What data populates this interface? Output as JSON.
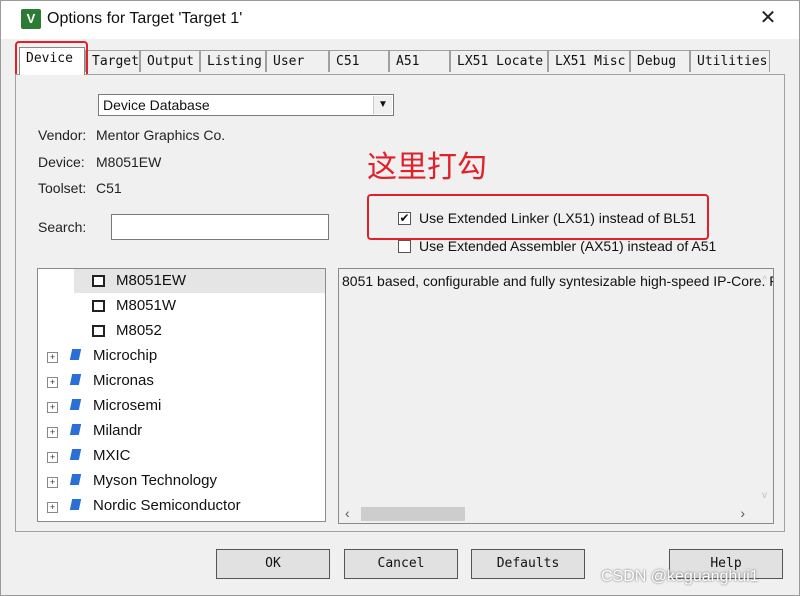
{
  "window": {
    "title": "Options for Target 'Target 1'",
    "close_glyph": "✕",
    "app_icon_glyph": "V"
  },
  "tabs": [
    "Device",
    "Target",
    "Output",
    "Listing",
    "User",
    "C51",
    "A51",
    "LX51 Locate",
    "LX51 Misc",
    "Debug",
    "Utilities"
  ],
  "device": {
    "database_select": "Device Database",
    "vendor_label": "Vendor:",
    "vendor_value": "Mentor Graphics Co.",
    "device_label": "Device:",
    "device_value": "M8051EW",
    "toolset_label": "Toolset:",
    "toolset_value": "C51",
    "search_label": "Search:",
    "search_value": ""
  },
  "annotation": "这里打勾",
  "options": {
    "linker": {
      "label": "Use Extended Linker (LX51) instead of BL51",
      "checked": true
    },
    "assembler": {
      "label": "Use Extended Assembler (AX51) instead of A51",
      "checked": false
    }
  },
  "tree": {
    "chips": [
      "M8051EW",
      "M8051W",
      "M8052"
    ],
    "vendors": [
      "Microchip",
      "Micronas",
      "Microsemi",
      "Milandr",
      "MXIC",
      "Myson Technology",
      "Nordic Semiconductor"
    ]
  },
  "description": "8051 based, configurable and fully syntesizable  high-speed IP-Core. F",
  "buttons": {
    "ok": "OK",
    "cancel": "Cancel",
    "defaults": "Defaults",
    "help": "Help"
  },
  "watermark": "CSDN @keguanghui1",
  "colors": {
    "highlight": "#e0212a",
    "selection": "#e5e5e5",
    "vendor_icon": "#2a6fd6"
  }
}
